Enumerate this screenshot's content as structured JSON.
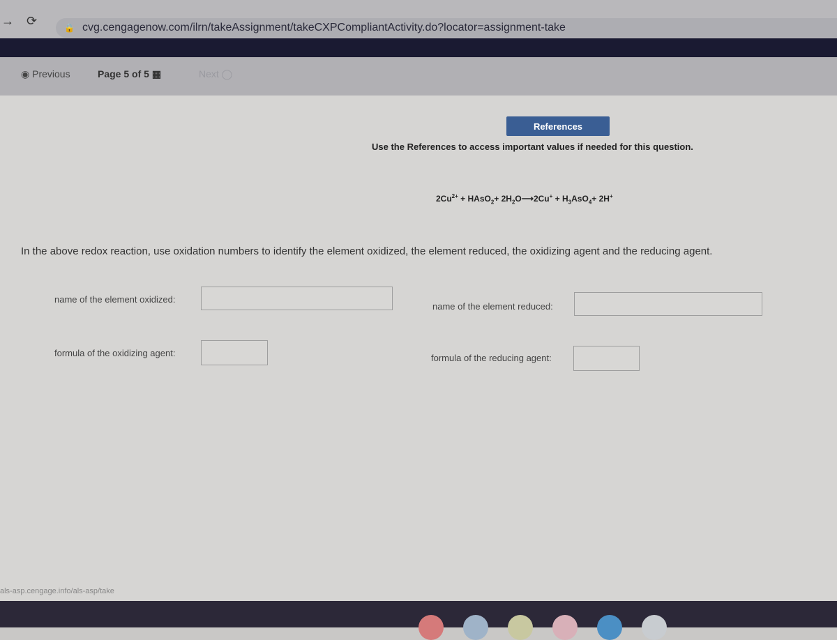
{
  "browser": {
    "url": "cvg.cengagenow.com/ilrn/takeAssignment/takeCXPCompliantActivity.do?locator=assignment-take"
  },
  "pager": {
    "previous": "Previous",
    "page": "Page 5 of 5",
    "next": "Next"
  },
  "references": {
    "button": "References",
    "hint": "Use the References to access important values if needed for this question."
  },
  "equation": {
    "lhs1": "2Cu",
    "lhs1_charge": "2+",
    "lhs2": "HAsO",
    "lhs2_sub": "2",
    "lhs3": "2H",
    "lhs3_sub": "2",
    "lhs3_end": "O",
    "rhs1": "2Cu",
    "rhs1_charge": "+",
    "rhs2": "H",
    "rhs2_sub": "3",
    "rhs2_mid": "AsO",
    "rhs2_sub2": "4",
    "rhs3": "2H",
    "rhs3_charge": "+"
  },
  "question": "In the above redox reaction, use oxidation numbers to identify the element oxidized, the element reduced, the oxidizing agent and the reducing agent.",
  "fields": {
    "oxidized": "name of the element oxidized:",
    "reduced": "name of the element reduced:",
    "oxidizing_agent": "formula of the oxidizing agent:",
    "reducing_agent": "formula of the reducing agent:"
  },
  "status_bar": "als-asp.cengage.info/als-asp/take",
  "taskbar": [
    "chrome-icon",
    "files-icon",
    "photos-icon",
    "gmail-icon",
    "docs-icon",
    "calendar-icon"
  ],
  "colors": {
    "references_button": "#3a5e94"
  }
}
